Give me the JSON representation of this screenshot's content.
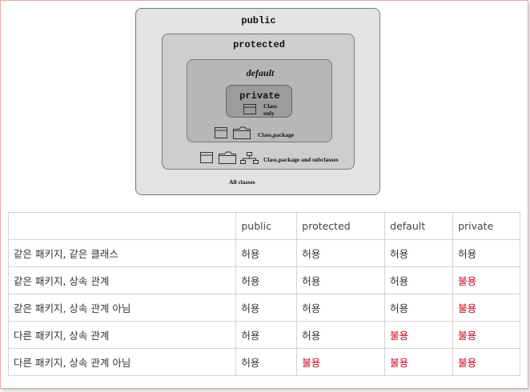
{
  "diagram": {
    "public_label": "public",
    "protected_label": "protected",
    "default_label": "default",
    "private_label": "private",
    "private_caption_line1": "Class",
    "private_caption_line2": "only",
    "default_caption": "Class,package",
    "protected_caption": "Class,package and subclasses",
    "public_caption": "All classes"
  },
  "table": {
    "headers": [
      "",
      "public",
      "protected",
      "default",
      "private"
    ],
    "rows": [
      {
        "label": "같은 패키지, 같은 클래스",
        "cells": [
          "허용",
          "허용",
          "허용",
          "허용"
        ],
        "denied": [
          false,
          false,
          false,
          false
        ]
      },
      {
        "label": "같은 패키지, 상속 관계",
        "cells": [
          "허용",
          "허용",
          "허용",
          "불용"
        ],
        "denied": [
          false,
          false,
          false,
          true
        ]
      },
      {
        "label": "같은 패키지, 상속 관계 아님",
        "cells": [
          "허용",
          "허용",
          "허용",
          "불용"
        ],
        "denied": [
          false,
          false,
          false,
          true
        ]
      },
      {
        "label": "다른 패키지, 상속 관계",
        "cells": [
          "허용",
          "허용",
          "불용",
          "불용"
        ],
        "denied": [
          false,
          false,
          true,
          true
        ]
      },
      {
        "label": "다른 패키지, 상속 관계 아님",
        "cells": [
          "허용",
          "불용",
          "불용",
          "불용"
        ],
        "denied": [
          false,
          true,
          true,
          true
        ]
      }
    ],
    "deny_color": "#c8001e"
  }
}
